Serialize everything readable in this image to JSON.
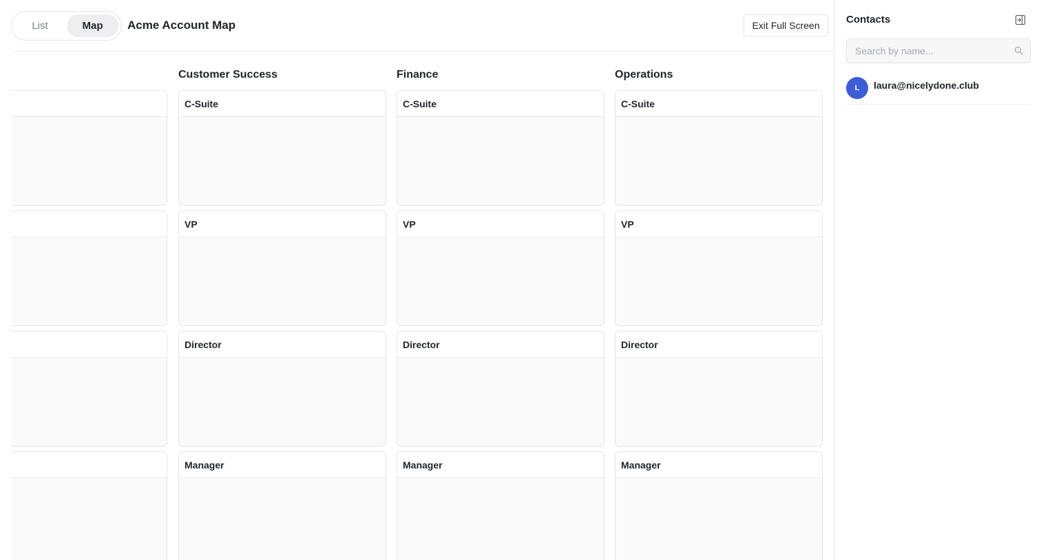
{
  "header": {
    "view_toggle": {
      "list_label": "List",
      "map_label": "Map",
      "selected": "Map"
    },
    "title": "Acme Account Map",
    "exit_label": "Exit Full Screen"
  },
  "columns": [
    {
      "name": "",
      "cards": [
        {
          "label": ""
        },
        {
          "label": ""
        },
        {
          "label": ""
        },
        {
          "label": ""
        }
      ]
    },
    {
      "name": "Customer Success",
      "cards": [
        {
          "label": "C-Suite"
        },
        {
          "label": "VP"
        },
        {
          "label": "Director"
        },
        {
          "label": "Manager"
        }
      ]
    },
    {
      "name": "Finance",
      "cards": [
        {
          "label": "C-Suite"
        },
        {
          "label": "VP"
        },
        {
          "label": "Director"
        },
        {
          "label": "Manager"
        }
      ]
    },
    {
      "name": "Operations",
      "cards": [
        {
          "label": "C-Suite"
        },
        {
          "label": "VP"
        },
        {
          "label": "Director"
        },
        {
          "label": "Manager"
        }
      ]
    }
  ],
  "sidebar": {
    "title": "Contacts",
    "collapse_icon": "panel-collapse-icon",
    "search": {
      "placeholder": "Search by name...",
      "value": ""
    },
    "contacts": [
      {
        "initial": "L",
        "email": "laura@nicelydone.club"
      }
    ]
  },
  "colors": {
    "avatar": "#3e5bd8",
    "toggle_selected_bg": "#eeeef0"
  }
}
